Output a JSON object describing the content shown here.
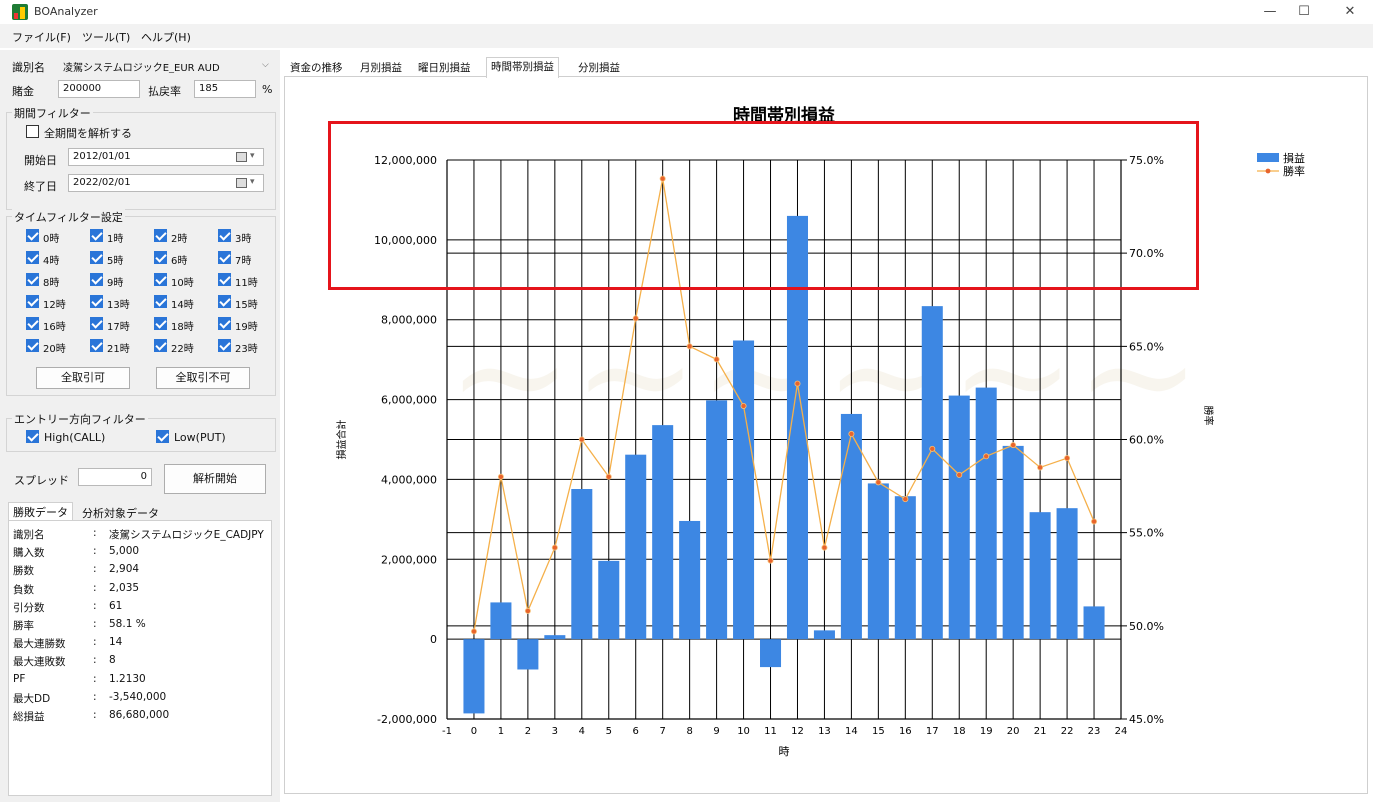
{
  "window": {
    "title": "BOAnalyzer",
    "minimize": "—",
    "maximize": "☐",
    "close": "✕"
  },
  "menu": [
    "ファイル(F)",
    "ツール(T)",
    "ヘルプ(H)"
  ],
  "left": {
    "id_label": "識別名",
    "id_value": "凌駕システムロジックE_EUR AUD",
    "stake_label": "賭金",
    "stake_value": "200000",
    "payout_label": "払戻率",
    "payout_value": "185",
    "payout_unit": "%",
    "period_group": "期間フィルター",
    "all_period_label": "全期間を解析する",
    "all_period_checked": false,
    "start_label": "開始日",
    "start_value": "2012/01/01",
    "end_label": "終了日",
    "end_value": "2022/02/01",
    "time_group": "タイムフィルター設定",
    "hours": [
      "0時",
      "1時",
      "2時",
      "3時",
      "4時",
      "5時",
      "6時",
      "7時",
      "8時",
      "9時",
      "10時",
      "11時",
      "12時",
      "13時",
      "14時",
      "15時",
      "16時",
      "17時",
      "18時",
      "19時",
      "20時",
      "21時",
      "22時",
      "23時"
    ],
    "allow_all": "全取引可",
    "deny_all": "全取引不可",
    "entry_group": "エントリー方向フィルター",
    "high_label": "High(CALL)",
    "low_label": "Low(PUT)",
    "spread_label": "スプレッド",
    "spread_value": "0",
    "analyze_button": "解析開始",
    "stats_tabs": [
      "勝敗データ",
      "分析対象データ"
    ],
    "stats": [
      {
        "label": "識別名",
        "value": "凌駕システムロジックE_CADJPY"
      },
      {
        "label": "購入数",
        "value": "5,000"
      },
      {
        "label": "勝数",
        "value": "2,904"
      },
      {
        "label": "負数",
        "value": "2,035"
      },
      {
        "label": "引分数",
        "value": "61"
      },
      {
        "label": "勝率",
        "value": "58.1 %"
      },
      {
        "label": "最大連勝数",
        "value": "14"
      },
      {
        "label": "最大連敗数",
        "value": "8"
      },
      {
        "label": "PF",
        "value": "1.2130"
      },
      {
        "label": "最大DD",
        "value": "-3,540,000"
      },
      {
        "label": "総損益",
        "value": "86,680,000"
      }
    ]
  },
  "tabs": [
    "資金の推移",
    "月別損益",
    "曜日別損益",
    "時間帯別損益",
    "分別損益"
  ],
  "active_tab": 3,
  "colors": {
    "bar": "#3d87e3",
    "line": "#f5b04a",
    "marker": "#e8642c",
    "highlight": "#e5141b"
  },
  "chart_data": {
    "type": "bar",
    "title": "時間帯別損益",
    "xlabel": "時",
    "ylabel": "損益合計",
    "y2label": "勝率",
    "xlim": [
      -1,
      24
    ],
    "ylim": [
      -2000000,
      12000000
    ],
    "y2lim": [
      45.0,
      75.0
    ],
    "x_ticks": [
      "-1",
      "0",
      "1",
      "2",
      "3",
      "4",
      "5",
      "6",
      "7",
      "8",
      "9",
      "10",
      "11",
      "12",
      "13",
      "14",
      "15",
      "16",
      "17",
      "18",
      "19",
      "20",
      "21",
      "22",
      "23",
      "24"
    ],
    "y_ticks": [
      "-2,000,000",
      "0",
      "2,000,000",
      "4,000,000",
      "6,000,000",
      "8,000,000",
      "10,000,000",
      "12,000,000"
    ],
    "y2_ticks": [
      "45.0%",
      "50.0%",
      "55.0%",
      "60.0%",
      "65.0%",
      "70.0%",
      "75.0%"
    ],
    "legend_position": "top-right",
    "grid": true,
    "categories": [
      0,
      1,
      2,
      3,
      4,
      5,
      6,
      7,
      8,
      9,
      10,
      11,
      12,
      13,
      14,
      15,
      16,
      17,
      18,
      19,
      20,
      21,
      22,
      23
    ],
    "series": [
      {
        "name": "損益",
        "type": "bar",
        "axis": "left",
        "values": [
          -1860000,
          920000,
          -760000,
          100000,
          3760000,
          1960000,
          4620000,
          5360000,
          2960000,
          5980000,
          7480000,
          -700000,
          10600000,
          220000,
          5640000,
          3900000,
          3580000,
          8340000,
          6100000,
          6300000,
          4840000,
          3180000,
          3280000,
          820000
        ]
      },
      {
        "name": "勝率",
        "type": "line",
        "axis": "right",
        "values": [
          49.7,
          58.0,
          50.8,
          54.2,
          60.0,
          58.0,
          66.5,
          74.0,
          65.0,
          64.3,
          61.8,
          53.5,
          63.0,
          54.2,
          60.3,
          57.7,
          56.8,
          59.5,
          58.1,
          59.1,
          59.7,
          58.5,
          59.0,
          55.6
        ]
      }
    ]
  }
}
